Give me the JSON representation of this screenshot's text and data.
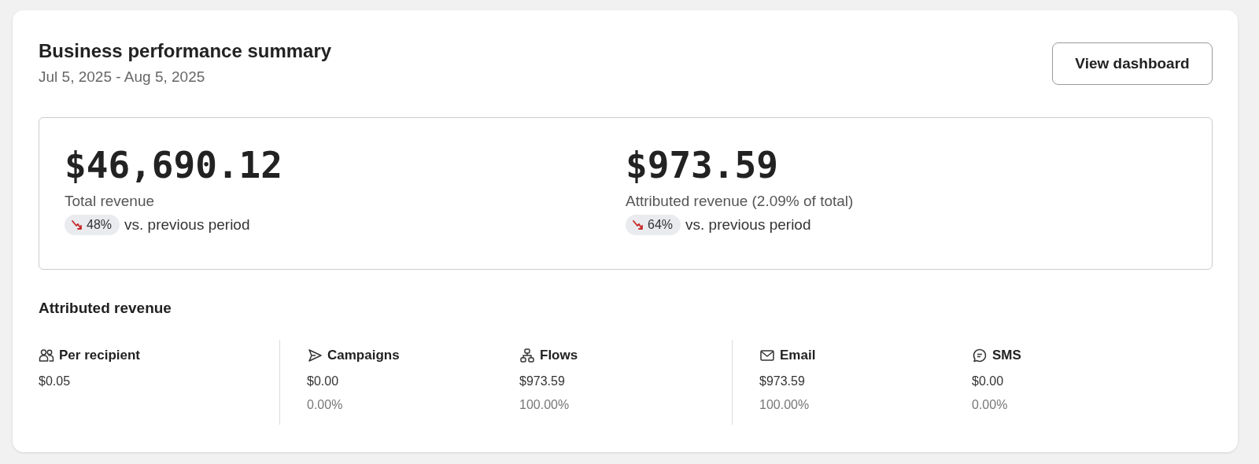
{
  "header": {
    "title": "Business performance summary",
    "date_range": "Jul 5, 2025 - Aug 5, 2025",
    "button": "View dashboard"
  },
  "metrics": [
    {
      "value": "$46,690.12",
      "label": "Total revenue",
      "kind": "down",
      "change": "48%",
      "comparison": "vs. previous period"
    },
    {
      "value": "$973.59",
      "label": "Attributed revenue (2.09% of total)",
      "kind": "down",
      "change": "64%",
      "comparison": "vs. previous period"
    }
  ],
  "attributed": {
    "title": "Attributed revenue",
    "groups": [
      {
        "items": [
          {
            "kind": "people",
            "label": "Per recipient",
            "value": "$0.05"
          }
        ]
      },
      {
        "items": [
          {
            "kind": "send",
            "label": "Campaigns",
            "value": "$0.00",
            "share": "0.00%"
          },
          {
            "kind": "flow",
            "label": "Flows",
            "value": "$973.59",
            "share": "100.00%"
          }
        ]
      },
      {
        "items": [
          {
            "kind": "mail",
            "label": "Email",
            "value": "$973.59",
            "share": "100.00%"
          },
          {
            "kind": "chat",
            "label": "SMS",
            "value": "$0.00",
            "share": "0.00%"
          }
        ]
      }
    ]
  }
}
